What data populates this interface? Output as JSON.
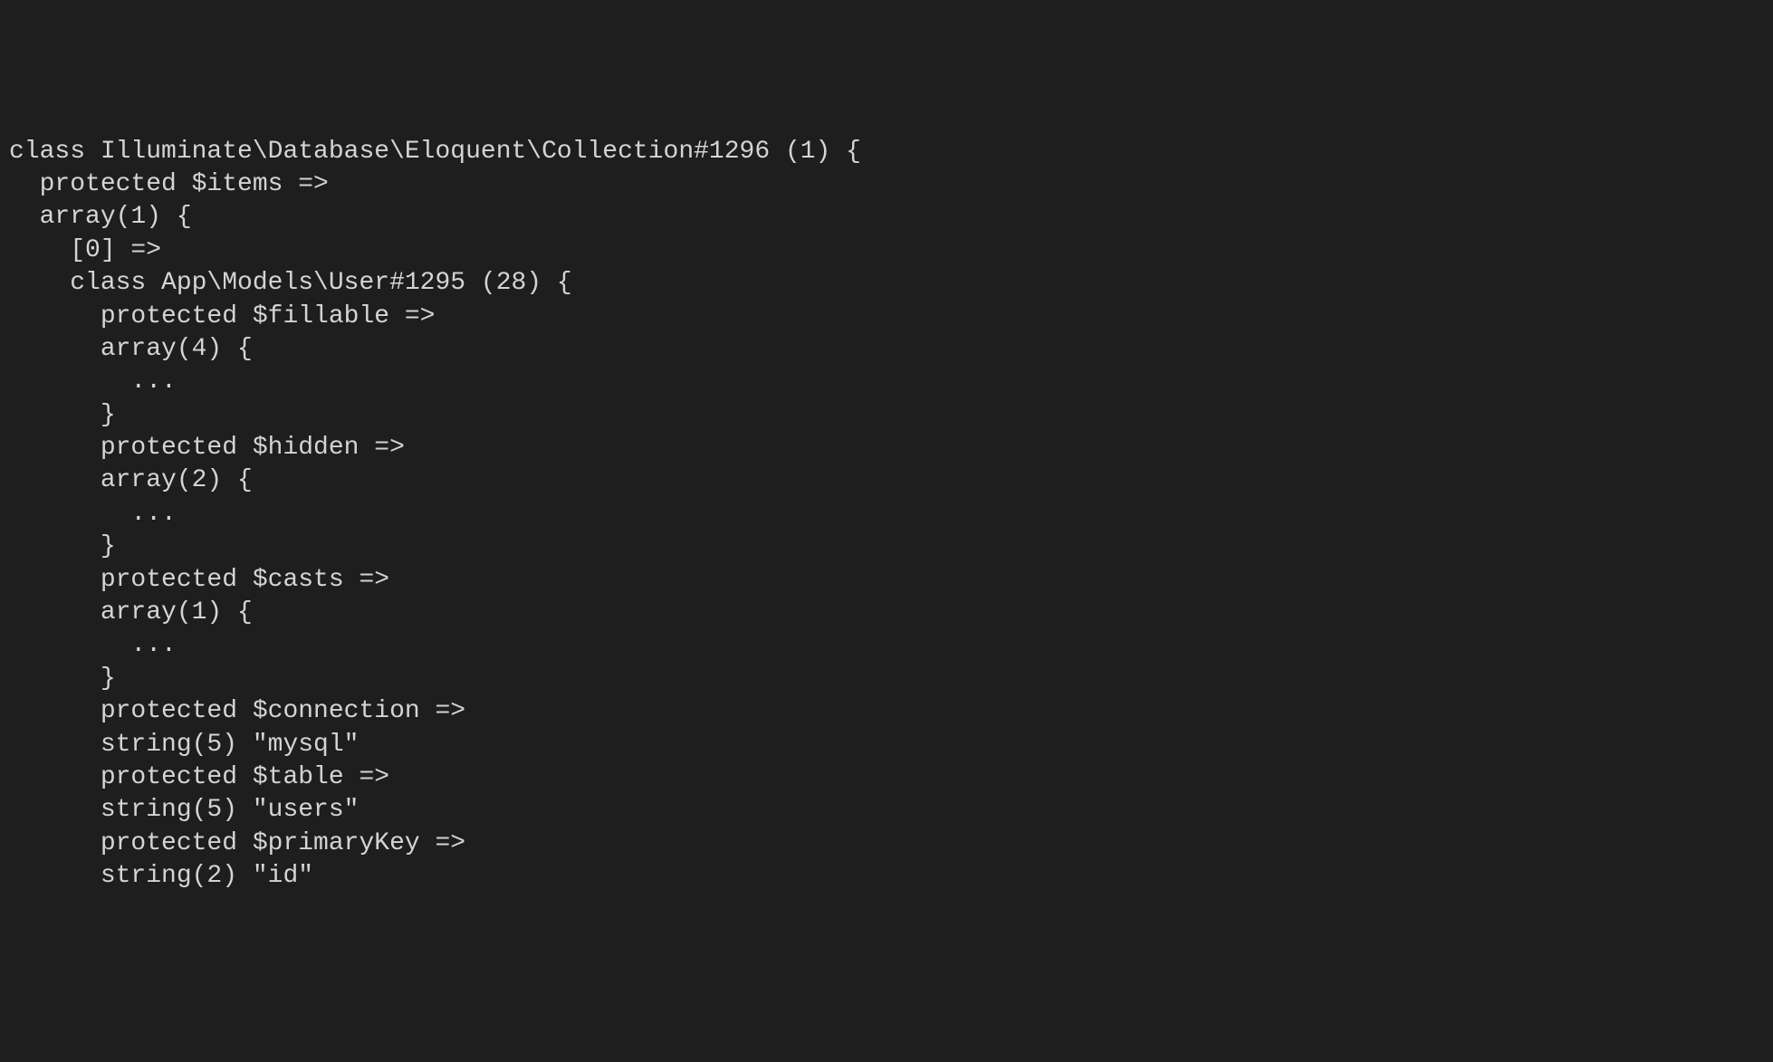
{
  "lines": [
    "class Illuminate\\Database\\Eloquent\\Collection#1296 (1) {",
    "  protected $items =>",
    "  array(1) {",
    "    [0] =>",
    "    class App\\Models\\User#1295 (28) {",
    "      protected $fillable =>",
    "      array(4) {",
    "        ...",
    "      }",
    "      protected $hidden =>",
    "      array(2) {",
    "        ...",
    "      }",
    "      protected $casts =>",
    "      array(1) {",
    "        ...",
    "      }",
    "      protected $connection =>",
    "      string(5) \"mysql\"",
    "      protected $table =>",
    "      string(5) \"users\"",
    "      protected $primaryKey =>",
    "      string(2) \"id\""
  ]
}
